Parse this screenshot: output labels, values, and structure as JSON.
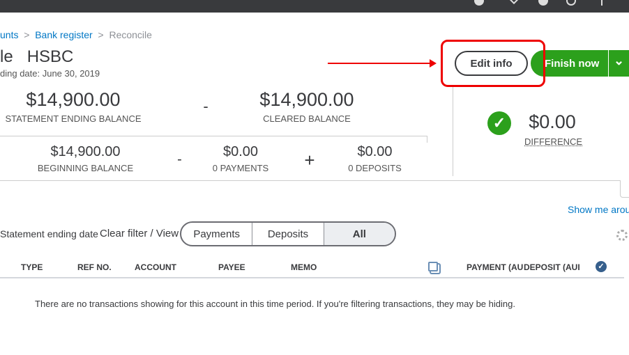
{
  "breadcrumb": {
    "item1": "unts",
    "sep": ">",
    "item2": "Bank register",
    "item3": "Reconcile"
  },
  "header": {
    "title_prefix": "le",
    "account": "HSBC",
    "ending_date": "ding date: June 30, 2019"
  },
  "actions": {
    "edit_info": "Edit info",
    "finish_now": "Finish now",
    "dropdown": "⌄"
  },
  "summary": {
    "statement_ending_balance": "$14,900.00",
    "statement_ending_balance_label": "STATEMENT ENDING BALANCE",
    "minus": "-",
    "cleared_balance": "$14,900.00",
    "cleared_balance_label": "CLEARED BALANCE",
    "beginning_balance": "$14,900.00",
    "beginning_balance_label": "BEGINNING BALANCE",
    "payments": "$0.00",
    "payments_label": "0 PAYMENTS",
    "plus": "+",
    "deposits": "$0.00",
    "deposits_label": "0 DEPOSITS",
    "difference": "$0.00",
    "difference_label": "DIFFERENCE"
  },
  "filter": {
    "statement_label": "Statement ending date",
    "clear_filter": "Clear filter / View",
    "tabs": [
      "Payments",
      "Deposits",
      "All"
    ],
    "selected": "All"
  },
  "show_me_around": "Show me arour",
  "table": {
    "columns": [
      "TYPE",
      "REF NO.",
      "ACCOUNT",
      "PAYEE",
      "MEMO",
      "PAYMENT (AU",
      "DEPOSIT (AUI"
    ],
    "empty_message": "There are no transactions showing for this account in this time period. If you're filtering transactions, they may be hiding."
  },
  "colors": {
    "green": "#2ca01c",
    "link": "#0077c5",
    "annotation": "#e00000"
  }
}
